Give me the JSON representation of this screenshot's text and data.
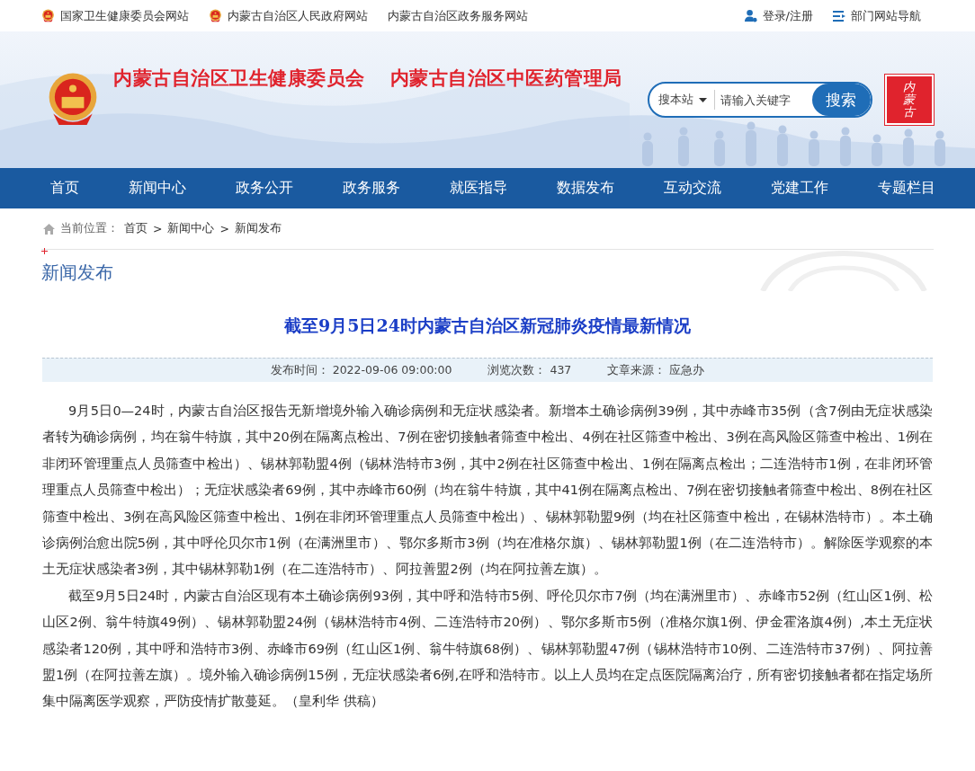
{
  "top_bar": {
    "left_links": [
      {
        "text": "国家卫生健康委员会网站",
        "kind": "emblem"
      },
      {
        "text": "内蒙古自治区人民政府网站",
        "kind": "emblem"
      },
      {
        "text": "内蒙古自治区政务服务网站",
        "kind": "plain"
      }
    ],
    "right_links": [
      {
        "text": "登录/注册",
        "kind": "user"
      },
      {
        "text": "部门网站导航",
        "kind": "list"
      }
    ]
  },
  "banner": {
    "titles": [
      "内蒙古自治区卫生健康委员会",
      "内蒙古自治区中医药管理局"
    ],
    "search": {
      "scope": "搜本站",
      "placeholder": "请输入关键字",
      "button": "搜索"
    },
    "seal": "内蒙古"
  },
  "nav": [
    "首页",
    "新闻中心",
    "政务公开",
    "政务服务",
    "就医指导",
    "数据发布",
    "互动交流",
    "党建工作",
    "专题栏目"
  ],
  "breadcrumb": {
    "label": "当前位置：",
    "items": [
      "首页",
      "新闻中心",
      "新闻发布"
    ],
    "separator": ">"
  },
  "section_title": "新闻发布",
  "article": {
    "title": "截至9月5日24时内蒙古自治区新冠肺炎疫情最新情况",
    "meta": [
      {
        "label": "发布时间：",
        "value": "2022-09-06 09:00:00"
      },
      {
        "label": "浏览次数：",
        "value": "437"
      },
      {
        "label": "文章来源：",
        "value": "应急办"
      }
    ],
    "paragraphs": [
      "9月5日0—24时，内蒙古自治区报告无新增境外输入确诊病例和无症状感染者。新增本土确诊病例39例，其中赤峰市35例（含7例由无症状感染者转为确诊病例，均在翁牛特旗，其中20例在隔离点检出、7例在密切接触者筛查中检出、4例在社区筛查中检出、3例在高风险区筛查中检出、1例在非闭环管理重点人员筛查中检出）、锡林郭勒盟4例（锡林浩特市3例，其中2例在社区筛查中检出、1例在隔离点检出；二连浩特市1例，在非闭环管理重点人员筛查中检出）；无症状感染者69例，其中赤峰市60例（均在翁牛特旗，其中41例在隔离点检出、7例在密切接触者筛查中检出、8例在社区筛查中检出、3例在高风险区筛查中检出、1例在非闭环管理重点人员筛查中检出）、锡林郭勒盟9例（均在社区筛查中检出，在锡林浩特市）。本土确诊病例治愈出院5例，其中呼伦贝尔市1例（在满洲里市）、鄂尔多斯市3例（均在准格尔旗）、锡林郭勒盟1例（在二连浩特市）。解除医学观察的本土无症状感染者3例，其中锡林郭勒1例（在二连浩特市）、阿拉善盟2例（均在阿拉善左旗）。",
      "截至9月5日24时，内蒙古自治区现有本土确诊病例93例，其中呼和浩特市5例、呼伦贝尔市7例（均在满洲里市）、赤峰市52例（红山区1例、松山区2例、翁牛特旗49例）、锡林郭勒盟24例（锡林浩特市4例、二连浩特市20例）、鄂尔多斯市5例（准格尔旗1例、伊金霍洛旗4例）,本土无症状感染者120例，其中呼和浩特市3例、赤峰市69例（红山区1例、翁牛特旗68例）、锡林郭勒盟47例（锡林浩特市10例、二连浩特市37例）、阿拉善盟1例（在阿拉善左旗）。境外输入确诊病例15例，无症状感染者6例,在呼和浩特市。以上人员均在定点医院隔离治疗，所有密切接触者都在指定场所集中隔离医学观察，严防疫情扩散蔓延。（皇利华  供稿）"
    ]
  }
}
